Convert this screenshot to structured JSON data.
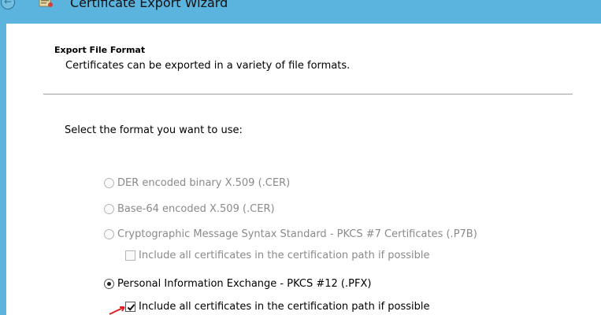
{
  "window": {
    "title": "Certificate Export Wizard",
    "back_icon": "back-arrow-icon",
    "wizard_icon": "certificate-wizard-icon"
  },
  "section": {
    "heading": "Export File Format",
    "description": "Certificates can be exported in a variety of file formats."
  },
  "prompt": "Select the format you want to use:",
  "options": [
    {
      "type": "radio",
      "label": "DER encoded binary X.509 (.CER)",
      "selected": false,
      "enabled": false
    },
    {
      "type": "radio",
      "label": "Base-64 encoded X.509 (.CER)",
      "selected": false,
      "enabled": false
    },
    {
      "type": "radio",
      "label": "Cryptographic Message Syntax Standard - PKCS #7 Certificates (.P7B)",
      "selected": false,
      "enabled": false
    },
    {
      "type": "checkbox",
      "label": "Include all certificates in the certification path if possible",
      "checked": false,
      "enabled": false
    },
    {
      "type": "radio",
      "label": "Personal Information Exchange - PKCS #12 (.PFX)",
      "selected": true,
      "enabled": true
    },
    {
      "type": "checkbox",
      "label": "Include all certificates in the certification path if possible",
      "checked": true,
      "enabled": true
    }
  ],
  "colors": {
    "titlebar": "#5bb4dd",
    "disabled_text": "#8a8a8a",
    "annotation_arrow": "#e02020"
  }
}
